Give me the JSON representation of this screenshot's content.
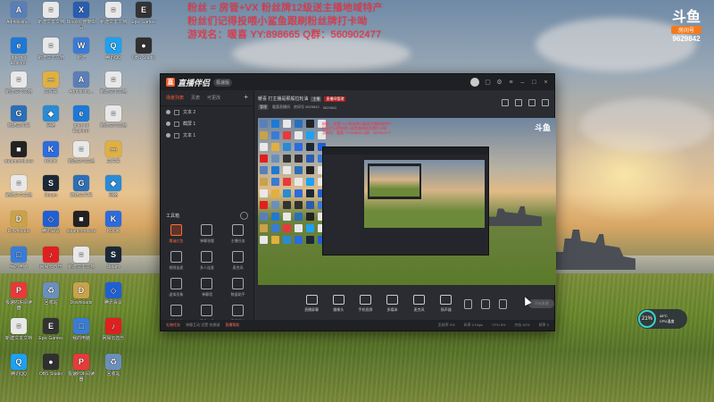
{
  "overlay": {
    "line1": "粉丝 = 房管+VX 粉丝牌12级送主播地域特产",
    "line2": "粉丝们记得投喂小鲨鱼跟刷粉丝牌打卡呦",
    "line3": "游戏名：暖喜 YY:898665 Q群：560902477"
  },
  "room_badge": {
    "logo": "斗鱼",
    "label": "房间号",
    "number": "9629842"
  },
  "desktop_icons": [
    {
      "label": "Administra...",
      "color": "#5a7fb8",
      "glyph": "A"
    },
    {
      "label": "Internet Explorer",
      "color": "#1e78d6",
      "glyph": "e"
    },
    {
      "label": "新建文本文档",
      "color": "#e8e8e8",
      "glyph": "≡"
    },
    {
      "label": "新建文件夹",
      "color": "#2b6fb8",
      "glyph": "G"
    },
    {
      "label": "steamcmd.exe",
      "color": "#222",
      "glyph": "■"
    },
    {
      "label": "新建文本文档",
      "color": "#e8e8e8",
      "glyph": "≡"
    },
    {
      "label": "Downloads",
      "color": "#c9a24a",
      "glyph": "D"
    },
    {
      "label": "我的电脑",
      "color": "#3a7bd5",
      "glyph": "□"
    },
    {
      "label": "极速PDF阅读器",
      "color": "#e83a3a",
      "glyph": "P"
    },
    {
      "label": "新建文本文档",
      "color": "#e8e8e8",
      "glyph": "≡"
    },
    {
      "label": "腾讯QQ",
      "color": "#1da1f2",
      "glyph": "Q"
    },
    {
      "label": "新建文本文档",
      "color": "#e8e8e8",
      "glyph": "≡"
    },
    {
      "label": "新建文本文档",
      "color": "#e8e8e8",
      "glyph": "≡"
    },
    {
      "label": "文件夹",
      "color": "#e0b040",
      "glyph": "▭"
    },
    {
      "label": "网络",
      "color": "#2a8ad4",
      "glyph": "◆"
    },
    {
      "label": "KOOK",
      "color": "#2c6be0",
      "glyph": "K"
    },
    {
      "label": "Steam",
      "color": "#1b2838",
      "glyph": "S"
    },
    {
      "label": "腾讯会议",
      "color": "#1f5fd6",
      "glyph": "◇"
    },
    {
      "label": "网易云音乐",
      "color": "#e02020",
      "glyph": "♪"
    },
    {
      "label": "回收站",
      "color": "#6a8fbd",
      "glyph": "♻"
    },
    {
      "label": "Epic Games",
      "color": "#333",
      "glyph": "E"
    },
    {
      "label": "OBS Studio",
      "color": "#303030",
      "glyph": "●"
    },
    {
      "label": "DirectX 修复工具",
      "color": "#2a5cb0",
      "glyph": "X"
    },
    {
      "label": "新建",
      "color": "#3a7bd5",
      "glyph": "W"
    }
  ],
  "app": {
    "name": "直播伴侣",
    "version": "极速版",
    "tabs": [
      "场景列表",
      "页表",
      "可更改"
    ],
    "add_tab": "+",
    "scenes": [
      "文本 2",
      "截屏 1",
      "文本 1"
    ],
    "tools_title": "工具箱",
    "tools": [
      {
        "label": "猜谜红包",
        "hot": true
      },
      {
        "label": "弹幕答题",
        "hot": false
      },
      {
        "label": "主播任务",
        "hot": false
      },
      {
        "label": "视频连麦",
        "hot": false
      },
      {
        "label": "多人连麦",
        "hot": false
      },
      {
        "label": "麦克风",
        "hot": false
      },
      {
        "label": "虚拟形象",
        "hot": false
      },
      {
        "label": "弹幕墙",
        "hot": false
      },
      {
        "label": "数据助手",
        "hot": false
      },
      {
        "label": "送礼特效",
        "hot": false
      },
      {
        "label": "更多工具",
        "hot": false
      },
      {
        "label": "直播回放",
        "hot": false
      }
    ],
    "header": {
      "title": "暖喜 打主播是那般拉轮油",
      "badge": "主播",
      "red_badge": "直播间管理",
      "sub_btn": "管理",
      "sub_info": "暖喜直播间",
      "sub_room": "房间号 9629842",
      "sub_fans": "9629842"
    },
    "bottom_buttons": [
      {
        "label": "直播屏幕"
      },
      {
        "label": "摄像头"
      },
      {
        "label": "手机投屏"
      },
      {
        "label": "多媒体"
      },
      {
        "label": "麦克风"
      },
      {
        "label": "扬声器"
      }
    ],
    "start_live": "开始直播",
    "status": {
      "left": "礼物任务",
      "mid": "弹幕互动 设置 快捷键",
      "right_link": "直播帮助",
      "stats": [
        "丢帧率 0%",
        "码率 0 Kbps",
        "CPU 8%",
        "内存 52%",
        "帧率 0"
      ]
    }
  },
  "perf_widget": {
    "value": "21%",
    "temp": "48°C",
    "label": "CPU温度"
  }
}
